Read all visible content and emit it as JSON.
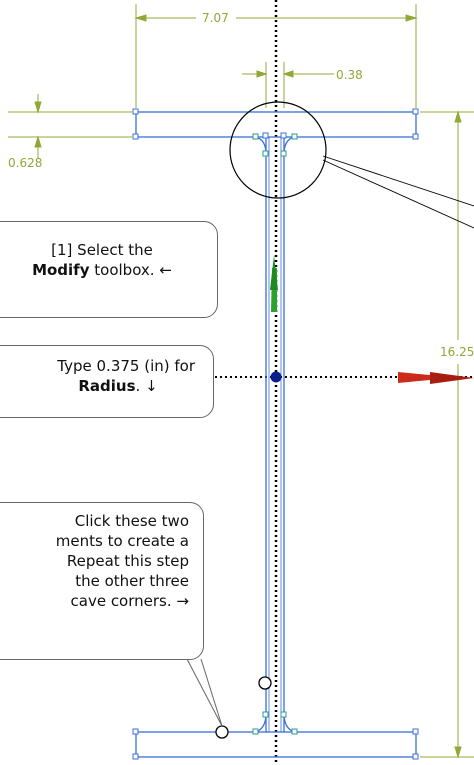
{
  "dimensions": {
    "flange_width": "7.07",
    "web_thickness": "0.38",
    "flange_thickness": "0.628",
    "depth": "16.25"
  },
  "callouts": {
    "select_modify": {
      "prefix": "[1] Select the",
      "bold": "Modify",
      "suffix": "toolbox.",
      "arrow": "←"
    },
    "type_radius": {
      "prefix": "Type 0.375 (in) for",
      "bold": "Radius",
      "suffix": ".",
      "arrow": "↓"
    },
    "click_elements": {
      "lines": [
        "Click these two",
        "ments to create a",
        "Repeat this step",
        "the other three",
        "cave corners."
      ],
      "arrow": "→"
    }
  },
  "colors": {
    "geometry": "#3a6fd8",
    "dimension": "#8fa838",
    "axis": "#000000",
    "x_arrow": "#cc2a1a",
    "y_arrow": "#2aa32a",
    "origin": "#0a1e8c"
  }
}
